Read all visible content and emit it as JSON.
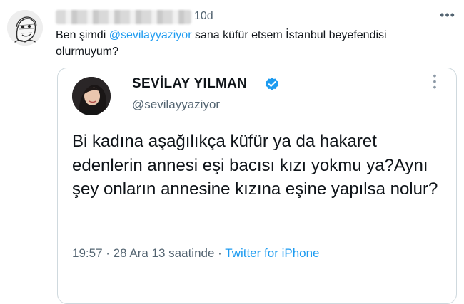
{
  "tweet": {
    "time": "10d",
    "text_prefix": "Ben şimdi ",
    "mention": "@sevilayyaziyor",
    "text_suffix": " sana küfür etsem İstanbul beyefendisi olurmuyum?",
    "more_icon": "more-horizontal-icon"
  },
  "quoted_tweet": {
    "name": "SEVİLAY YILMAN",
    "handle": "@sevilayyaziyor",
    "verified_icon": "verified-badge-icon",
    "body": "Bi kadına aşağılıkça küfür ya da hakaret edenlerin annesi eşi bacısı kızı yokmu ya?Aynı şey onların annesine kızına eşine yapılsa nolur?",
    "timestamp": "19:57 · 28 Ara 13 saatinde · ",
    "source": "Twitter for iPhone"
  },
  "colors": {
    "link": "#1d9bf0",
    "secondary_text": "#536471",
    "border": "#cfd9de"
  }
}
